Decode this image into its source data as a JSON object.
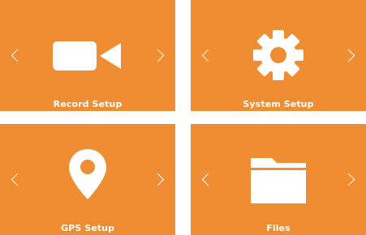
{
  "screens": [
    {
      "id": "record",
      "label": "Record Setup",
      "icon": "video-camera-icon"
    },
    {
      "id": "system",
      "label": "System Setup",
      "icon": "gear-icon"
    },
    {
      "id": "gps",
      "label": "GPS Setup",
      "icon": "map-pin-icon"
    },
    {
      "id": "files",
      "label": "Files",
      "icon": "folder-icon"
    }
  ],
  "colors": {
    "panel_background": "#f08c32",
    "foreground": "#ffffff",
    "page_background": "#ffffff"
  }
}
